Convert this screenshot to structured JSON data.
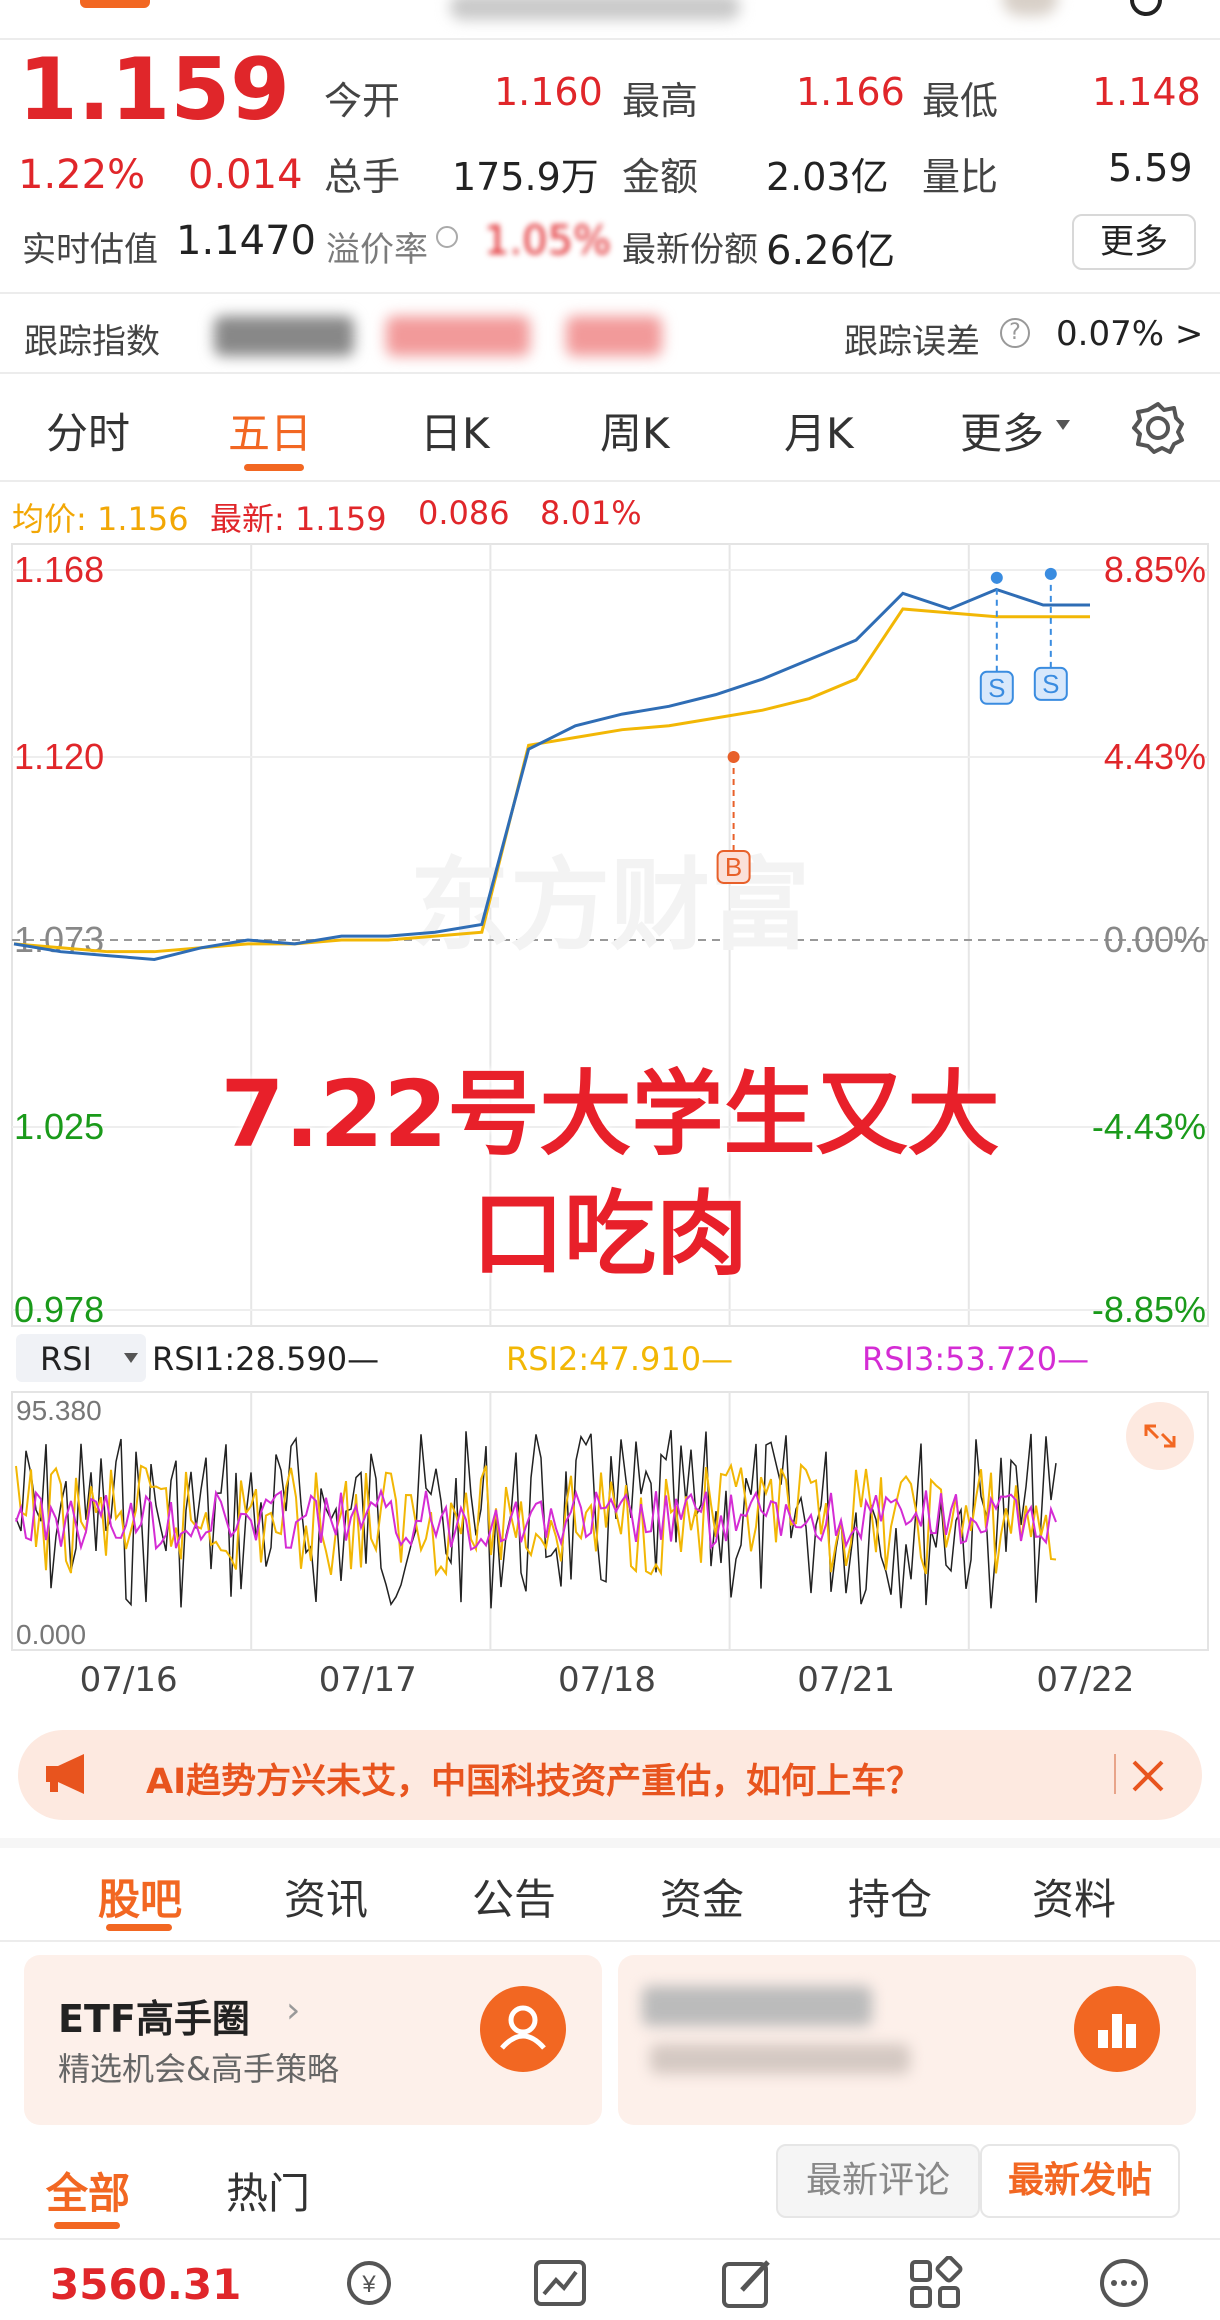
{
  "quote": {
    "price": "1.159",
    "change_pct": "1.22%",
    "change": "0.014",
    "open_label": "今开",
    "open": "1.160",
    "high_label": "最高",
    "high": "1.166",
    "low_label": "最低",
    "low": "1.148",
    "volume_label": "总手",
    "volume": "175.9万",
    "amount_label": "金额",
    "amount": "2.03亿",
    "ratio_label": "量比",
    "ratio": "5.59",
    "nav_label": "实时估值",
    "nav": "1.1470",
    "premium_label": "溢价率",
    "premium": "1.05%",
    "shares_label": "最新份额",
    "shares": "6.26亿",
    "more_label": "更多"
  },
  "tracking": {
    "index_label": "跟踪指数",
    "error_label": "跟踪误差",
    "error_value": "0.07% >"
  },
  "chart_tabs": [
    "分时",
    "五日",
    "日K",
    "周K",
    "月K",
    "更多"
  ],
  "chart_tabs_active": 1,
  "chart_header": {
    "avg": "均价: 1.156",
    "latest": "最新: 1.159",
    "change": "0.086",
    "change_pct": "8.01%"
  },
  "overlay_text": {
    "line1": "7.22号大学生又大",
    "line2": "口吃肉"
  },
  "watermark": "东方财富",
  "rsi": {
    "selector": "RSI",
    "rsi1": "RSI1:28.590—",
    "rsi2": "RSI2:47.910—",
    "rsi3": "RSI3:53.720—",
    "top": "95.380",
    "bottom": "0.000"
  },
  "chart_data": {
    "type": "line",
    "x": [
      "07/16",
      "07/17",
      "07/18",
      "07/21",
      "07/22"
    ],
    "ylim": [
      0.978,
      1.168
    ],
    "y_ticks_left": [
      "1.168",
      "1.120",
      "1.073",
      "1.025",
      "0.978"
    ],
    "y_ticks_right": [
      "8.85%",
      "4.43%",
      "0.00%",
      "-4.43%",
      "-8.85%"
    ],
    "series": [
      {
        "name": "最新",
        "color": "#2f6db5",
        "values": [
          1.072,
          1.07,
          1.069,
          1.068,
          1.071,
          1.073,
          1.072,
          1.074,
          1.074,
          1.075,
          1.077,
          1.122,
          1.128,
          1.131,
          1.133,
          1.136,
          1.14,
          1.145,
          1.15,
          1.162,
          1.158,
          1.163,
          1.159,
          1.159
        ]
      },
      {
        "name": "均价",
        "color": "#f2b705",
        "values": [
          1.072,
          1.071,
          1.07,
          1.07,
          1.071,
          1.072,
          1.072,
          1.073,
          1.073,
          1.074,
          1.075,
          1.123,
          1.125,
          1.127,
          1.128,
          1.13,
          1.132,
          1.135,
          1.14,
          1.158,
          1.157,
          1.156,
          1.156,
          1.156
        ]
      }
    ],
    "markers": [
      {
        "label": "B",
        "x": "07/21",
        "value": 1.12
      },
      {
        "label": "S",
        "x": "07/22",
        "value": 1.166
      },
      {
        "label": "S",
        "x": "07/22",
        "value": 1.167
      }
    ]
  },
  "banner": {
    "text": "AI趋势方兴未艾，中国科技资产重估，如何上车？"
  },
  "section_tabs": [
    "股吧",
    "资讯",
    "公告",
    "资金",
    "持仓",
    "资料"
  ],
  "section_tabs_active": 0,
  "cards": {
    "left_title": "ETF高手圈",
    "left_subtitle": "精选机会&高手策略"
  },
  "feed_tabs": {
    "all": "全部",
    "hot": "热门",
    "latest_comment": "最新评论",
    "latest_post": "最新发帖"
  },
  "bottom": {
    "index_value": "3560.31"
  },
  "colors": {
    "up": "#e0262a",
    "down": "#1a9a1a",
    "accent": "#f26722",
    "price_line": "#2f6db5",
    "avg_line": "#f2b705",
    "rsi3": "#d42cd4"
  }
}
